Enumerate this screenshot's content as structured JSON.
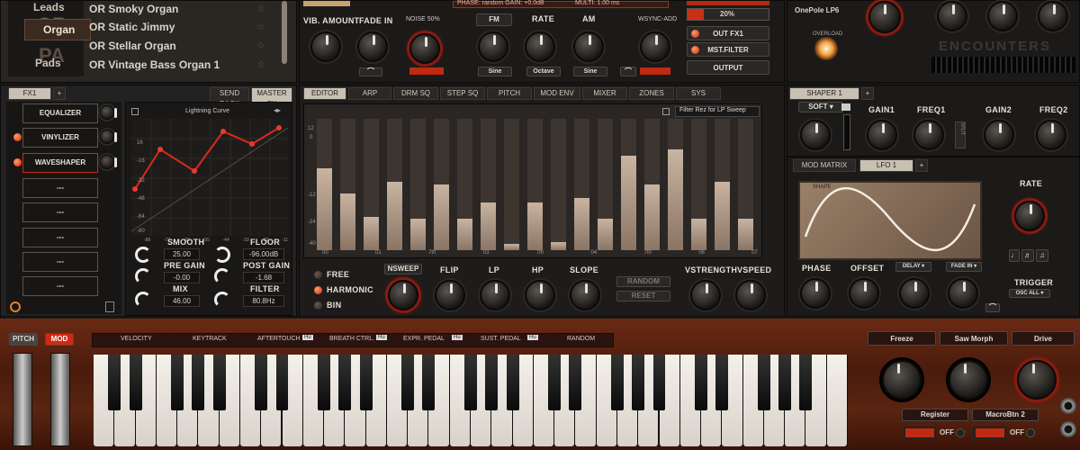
{
  "browser": {
    "categories": [
      "Leads",
      "Organ",
      "Pads"
    ],
    "category_big": [
      "OR",
      "PA"
    ],
    "presets": [
      "OR Smoky Organ",
      "OR Static Jimmy",
      "OR Stellar Organ",
      "OR Vintage Bass Organ 1"
    ]
  },
  "osc_top": {
    "labels": [
      "VIB. AMOUNT",
      "FADE IN",
      "NOISE 50%",
      "FM",
      "RATE",
      "AM",
      "WSYNC-ADD"
    ],
    "sub": [
      "Sine",
      "Octave",
      "Sine"
    ],
    "phase_text": "PHASE: random  GAIN: +0.0dB",
    "multi": "MULTI: 1.00 ms"
  },
  "fx_routing": {
    "pct": "20%",
    "buttons": [
      "OUT FX1",
      "MST.FILTER",
      "OUTPUT"
    ]
  },
  "top_right": {
    "filter": "OnePole LP6",
    "overload": "OVERLOAD",
    "brand": "ENCOUNTERS"
  },
  "fx_panel": {
    "tab": "FX1",
    "plus": "+",
    "send_rack": "SEND RACK",
    "master_fx": "MASTER FX",
    "slots": [
      "EQUALIZER",
      "VINYLIZER",
      "WAVESHAPER",
      "---",
      "---",
      "---",
      "---",
      "---"
    ],
    "curve_title": "Lightning Curve",
    "y_ticks": [
      "16",
      "-16",
      "-32",
      "-48",
      "-64",
      "-80"
    ],
    "x_ticks": [
      "-88",
      "-77",
      "-66",
      "-55",
      "-44",
      "-33",
      "-22",
      "-11"
    ],
    "params": [
      {
        "label": "SMOOTH",
        "value": "25.00"
      },
      {
        "label": "FLOOR",
        "value": "-96.00dB"
      },
      {
        "label": "PRE GAIN",
        "value": "-0.00"
      },
      {
        "label": "POST GAIN",
        "value": "-1.68"
      },
      {
        "label": "MIX",
        "value": "46.00"
      },
      {
        "label": "FILTER",
        "value": "80.8Hz"
      }
    ]
  },
  "editor": {
    "tabs": [
      "EDITOR",
      "ARP",
      "DRM SQ",
      "STEP SQ",
      "PITCH",
      "MOD ENV",
      "MIXER",
      "ZONES",
      "SYS"
    ],
    "dropdown": "Filter Rez for LP Sweep",
    "y_ticks": [
      "12",
      "0",
      "-12",
      "-24",
      "-40"
    ],
    "x_ticks": [
      "00",
      "01",
      "7th",
      "03",
      "7th",
      "04",
      "7th",
      "06",
      "07"
    ],
    "bars": [
      0.62,
      0.43,
      0.25,
      0.52,
      0.24,
      0.5,
      0.24,
      0.36,
      0.05,
      0.36,
      0.06,
      0.4,
      0.24,
      0.72,
      0.5,
      0.77,
      0.24,
      0.52,
      0.24
    ],
    "modes": [
      "FREE",
      "HARMONIC",
      "BIN"
    ],
    "knobs": [
      "NSWEEP",
      "FLIP",
      "LP",
      "HP",
      "SLOPE"
    ],
    "random": "RANDOM",
    "reset": "RESET",
    "vknobs": [
      "VSTRENGTH",
      "VSPEED"
    ]
  },
  "shaper": {
    "tab": "SHAPER 1",
    "plus": "+",
    "mode": "SOFT",
    "knobs": [
      "GAIN1",
      "FREQ1",
      "GAIN2",
      "FREQ2"
    ],
    "split": "SPLIT"
  },
  "mod": {
    "tabs": [
      "MOD MATRIX",
      "LFO 1",
      "+"
    ],
    "shape_label": "SHAPE",
    "rate": "RATE",
    "knobs": [
      "PHASE",
      "OFFSET",
      "DELAY",
      "FADE IN"
    ],
    "delay": "DELAY",
    "fadein": "FADE IN",
    "trigger": "TRIGGER",
    "trigger_val": "OSC ALL"
  },
  "keyboard": {
    "pitch": "PITCH",
    "mod": "MOD",
    "sources": [
      "VELOCITY",
      "KEYTRACK",
      "AFTERTOUCH",
      "BREATH CTRL.",
      "EXPR. PEDAL",
      "SUST. PEDAL",
      "RANDOM"
    ],
    "badge": "Hu",
    "macros": [
      "Freeze",
      "Saw Morph",
      "Drive"
    ],
    "register": "Register",
    "macrobtn": "MacroBtn 2",
    "off": "OFF"
  },
  "colors": {
    "accent": "#e0301a",
    "panel": "#1e1c1a",
    "wood": "#5a2410"
  }
}
